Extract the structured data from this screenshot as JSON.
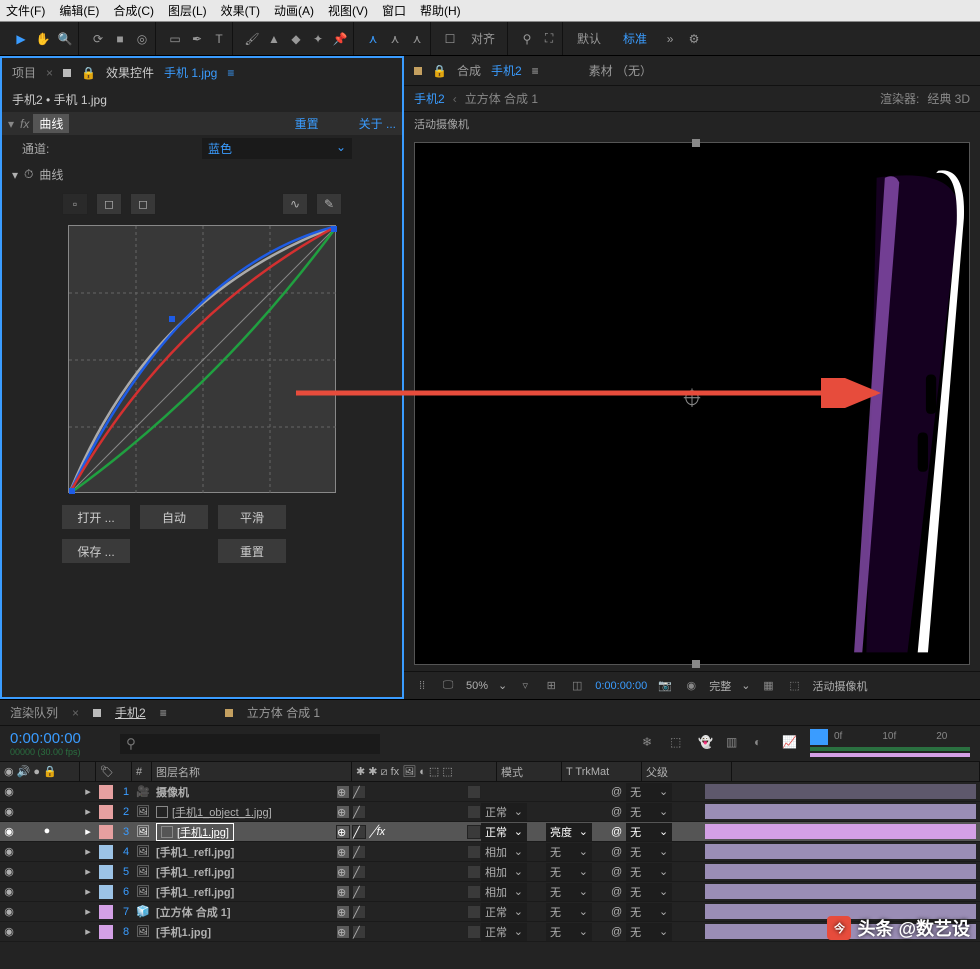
{
  "menubar": [
    "文件(F)",
    "编辑(E)",
    "合成(C)",
    "图层(L)",
    "效果(T)",
    "动画(A)",
    "视图(V)",
    "窗口",
    "帮助(H)"
  ],
  "toolbar": {
    "align": "对齐",
    "default": "默认",
    "standard": "标准"
  },
  "left": {
    "tab_project": "项目",
    "tab_fx": "效果控件",
    "tab_fx_file": "手机 1.jpg",
    "breadcrumb": "手机2 • 手机 1.jpg",
    "fx_name": "曲线",
    "reset": "重置",
    "about": "关于 ...",
    "channel_label": "通道:",
    "channel_value": "蓝色",
    "curve_label": "曲线",
    "btn_open": "打开 ...",
    "btn_auto": "自动",
    "btn_smooth": "平滑",
    "btn_save": "保存 ...",
    "btn_reset": "重置"
  },
  "comp": {
    "tab_comp": "合成",
    "tab_comp_name": "手机2",
    "footage": "素材 （无）",
    "crumb_main": "手机2",
    "crumb_sub": "立方体 合成 1",
    "renderer_label": "渲染器:",
    "renderer_value": "经典 3D",
    "camera": "活动摄像机",
    "zoom": "50%",
    "time": "0:00:00:00",
    "quality": "完整",
    "active_cam": "活动摄像机"
  },
  "timeline": {
    "tab_render": "渲染队列",
    "tab_comp": "手机2",
    "tab_sub": "立方体 合成 1",
    "time": "0:00:00:00",
    "fps": "00000 (30.00 fps)",
    "col_num": "#",
    "col_name": "图层名称",
    "col_mode": "模式",
    "col_trk": "T  TrkMat",
    "col_parent": "父级",
    "ruler": [
      "0f",
      "10f",
      "20"
    ],
    "none": "无",
    "layers": [
      {
        "n": "1",
        "tag": "#e6a0a0",
        "ico": "cam",
        "name": "摄像机",
        "mode": "",
        "trk": "",
        "sel": false,
        "fx": false
      },
      {
        "n": "2",
        "tag": "#e6a0a0",
        "ico": "img",
        "name": "[手机1_object_1.jpg]",
        "mode": "正常",
        "trk": "",
        "sel": false,
        "box": true,
        "fx": false
      },
      {
        "n": "3",
        "tag": "#e6a0a0",
        "ico": "img",
        "name": "[手机1.jpg]",
        "mode": "正常",
        "trk": "亮度",
        "sel": true,
        "box": true,
        "fx": true
      },
      {
        "n": "4",
        "tag": "#9cc3e6",
        "ico": "img",
        "name": "[手机1_refl.jpg]",
        "mode": "相加",
        "trk": "无",
        "sel": false,
        "fx": false
      },
      {
        "n": "5",
        "tag": "#9cc3e6",
        "ico": "img",
        "name": "[手机1_refl.jpg]",
        "mode": "相加",
        "trk": "无",
        "sel": false,
        "fx": false
      },
      {
        "n": "6",
        "tag": "#9cc3e6",
        "ico": "img",
        "name": "[手机1_refl.jpg]",
        "mode": "相加",
        "trk": "无",
        "sel": false,
        "fx": false
      },
      {
        "n": "7",
        "tag": "#d4a0e6",
        "ico": "comp",
        "name": "[立方体 合成 1]",
        "mode": "正常",
        "trk": "无",
        "sel": false,
        "fx": false
      },
      {
        "n": "8",
        "tag": "#d4a0e6",
        "ico": "img",
        "name": "[手机1.jpg]",
        "mode": "正常",
        "trk": "无",
        "sel": false,
        "fx": false
      }
    ]
  },
  "watermark": "头条 @数艺设"
}
